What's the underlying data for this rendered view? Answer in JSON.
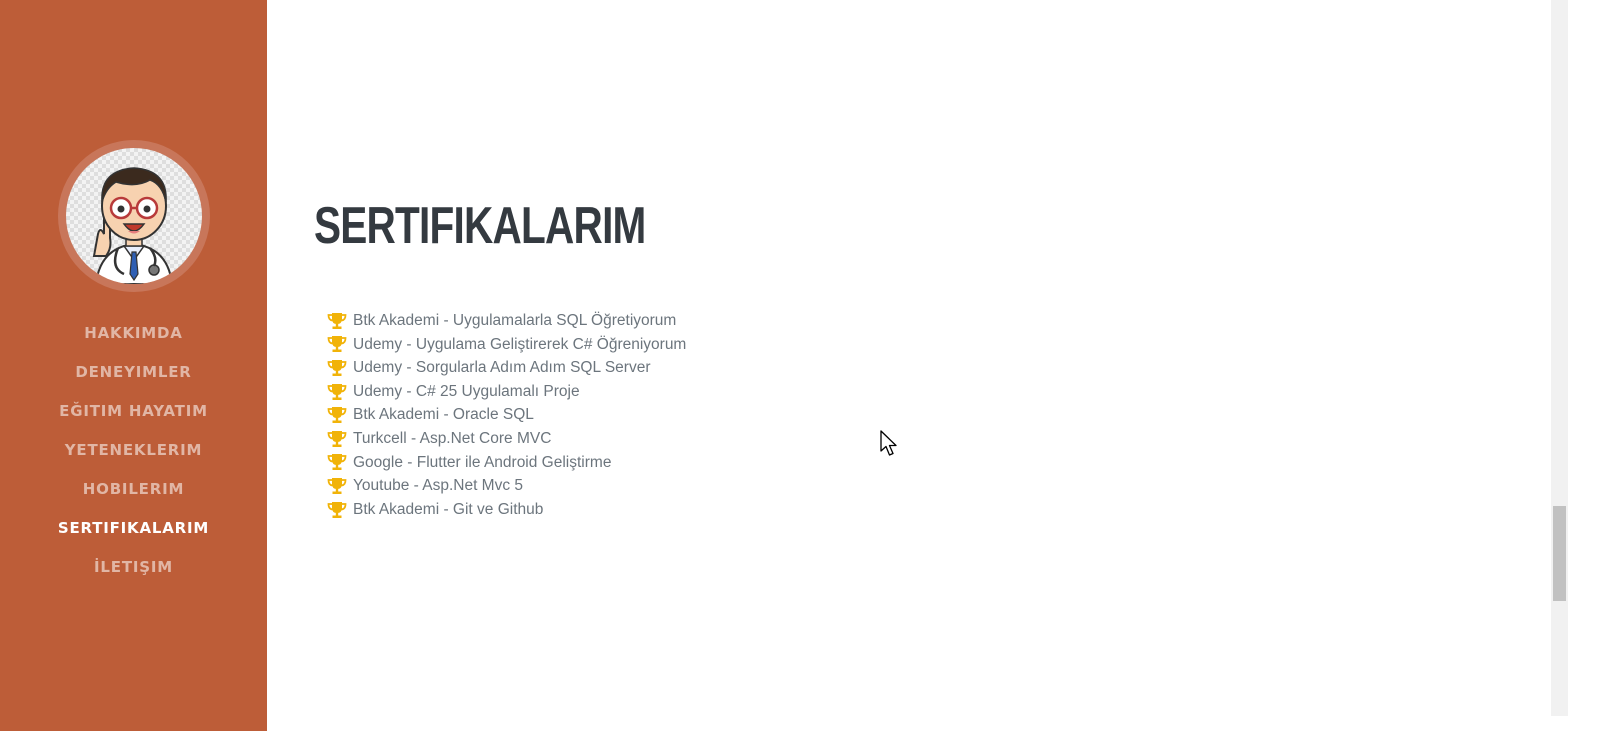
{
  "sidebar": {
    "avatar_alt": "Profile avatar",
    "nav": [
      {
        "label": "HAKKIMDA",
        "active": false
      },
      {
        "label": "DENEYIMLER",
        "active": false
      },
      {
        "label": "EĞITIM HAYATIM",
        "active": false
      },
      {
        "label": "YETENEKLERIM",
        "active": false
      },
      {
        "label": "HOBILERIM",
        "active": false
      },
      {
        "label": "SERTIFIKALARIM",
        "active": true
      },
      {
        "label": "İLETIŞIM",
        "active": false
      }
    ],
    "colors": {
      "background": "#bd5d38",
      "active_text": "#ffffff"
    }
  },
  "main": {
    "title": "SERTIFIKALARIM",
    "certificates": [
      "Btk Akademi - Uygulamalarla SQL Öğretiyorum",
      "Udemy - Uygulama Geliştirerek C# Öğreniyorum",
      "Udemy - Sorgularla Adım Adım SQL Server",
      "Udemy - C# 25 Uygulamalı Proje",
      "Btk Akademi - Oracle SQL",
      "Turkcell - Asp.Net Core MVC",
      "Google - Flutter ile Android Geliştirme",
      "Youtube - Asp.Net Mvc 5",
      "Btk Akademi - Git ve Github"
    ],
    "icon": "trophy-icon",
    "colors": {
      "trophy": "#f1b308",
      "text": "#6c757d",
      "title": "#343a40"
    }
  },
  "scrollbar": {
    "position_fraction": 0.78
  }
}
